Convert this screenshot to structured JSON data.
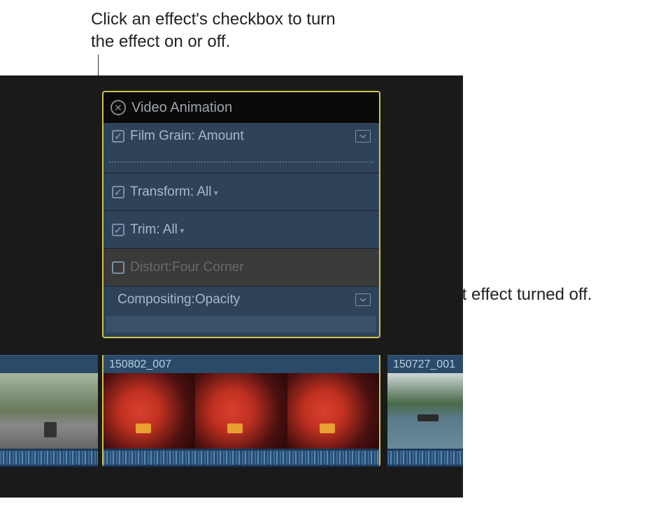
{
  "callouts": {
    "top": "Click an effect's checkbox to turn the effect on or off.",
    "right": "Distort effect turned off."
  },
  "panel": {
    "title": "Video Animation"
  },
  "effects": [
    {
      "label": "Film Grain: Amount",
      "checked": true,
      "has_expand": true,
      "has_dotted": true,
      "has_dropdown": false
    },
    {
      "label": "Transform: All",
      "checked": true,
      "has_expand": false,
      "has_dotted": false,
      "has_dropdown": true
    },
    {
      "label": "Trim: All",
      "checked": true,
      "has_expand": false,
      "has_dotted": false,
      "has_dropdown": true
    },
    {
      "label": "Distort:Four Corner",
      "checked": false,
      "has_expand": false,
      "has_dotted": false,
      "has_dropdown": false
    },
    {
      "label": "Compositing:Opacity",
      "checked": null,
      "has_expand": true,
      "has_dotted": false,
      "has_dropdown": false,
      "has_strip": true
    }
  ],
  "clips": {
    "b_label": "150802_007",
    "c_label": "150727_001"
  }
}
